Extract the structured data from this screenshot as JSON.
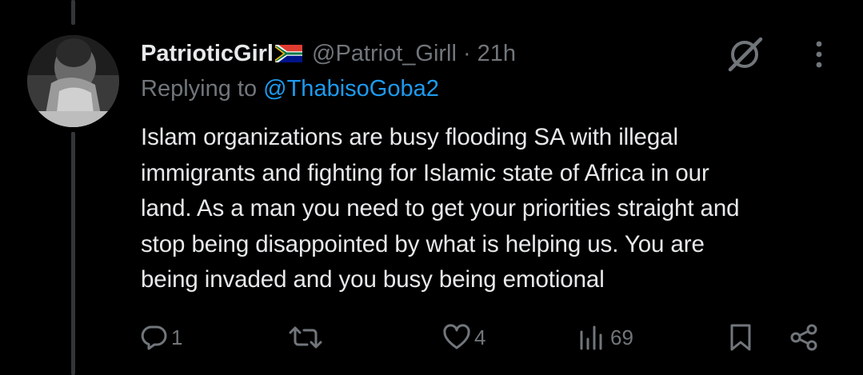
{
  "tweet": {
    "display_name": "PatrioticGirl",
    "flag_icon": "south-africa-flag-icon",
    "handle": "@Patriot_Girll",
    "separator": "·",
    "time": "21h",
    "replying_prefix": "Replying to",
    "replying_to": "@ThabisoGoba2",
    "text_lines": [
      "Islam organizations are busy flooding SA with illegal",
      "immigrants and fighting for Islamic state of Africa in our",
      "land. As a man you need to get your priorities straight and",
      "stop being disappointed by what is helping us. You are",
      "being invaded and you busy being emotional"
    ]
  },
  "actions": {
    "reply_count": "1",
    "retweet_count": "",
    "like_count": "4",
    "view_count": "69"
  },
  "icons": [
    "reply-icon",
    "retweet-icon",
    "like-icon",
    "views-icon",
    "bookmark-icon",
    "share-icon",
    "grok-icon",
    "more-icon"
  ],
  "colors": {
    "background": "#000000",
    "text": "#e7e9ea",
    "muted": "#71767b",
    "link": "#1d9bf0",
    "thread_line": "#333639"
  }
}
